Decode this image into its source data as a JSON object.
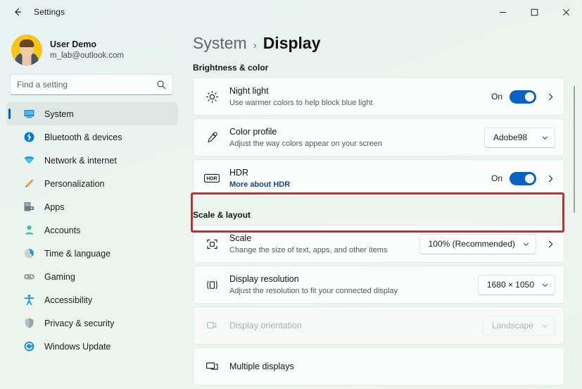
{
  "window": {
    "title": "Settings",
    "back_label": "back-arrow",
    "minimize_label": "Minimize",
    "maximize_label": "Maximize",
    "close_label": "Close"
  },
  "profile": {
    "name": "User Demo",
    "email": "m_lab@outlook.com"
  },
  "search": {
    "placeholder": "Find a setting",
    "value": ""
  },
  "sidebar": {
    "items": [
      {
        "label": "System",
        "icon": "monitor-icon",
        "active": true
      },
      {
        "label": "Bluetooth & devices",
        "icon": "bluetooth-icon",
        "active": false
      },
      {
        "label": "Network & internet",
        "icon": "wifi-icon",
        "active": false
      },
      {
        "label": "Personalization",
        "icon": "brush-icon",
        "active": false
      },
      {
        "label": "Apps",
        "icon": "apps-icon",
        "active": false
      },
      {
        "label": "Accounts",
        "icon": "account-icon",
        "active": false
      },
      {
        "label": "Time & language",
        "icon": "clock-icon",
        "active": false
      },
      {
        "label": "Gaming",
        "icon": "gamepad-icon",
        "active": false
      },
      {
        "label": "Accessibility",
        "icon": "accessibility-icon",
        "active": false
      },
      {
        "label": "Privacy & security",
        "icon": "shield-icon",
        "active": false
      },
      {
        "label": "Windows Update",
        "icon": "update-icon",
        "active": false
      }
    ]
  },
  "breadcrumb": {
    "parent": "System",
    "separator": "›",
    "current": "Display"
  },
  "sections": [
    {
      "heading": "Brightness & color",
      "rows": [
        {
          "icon": "brightness-icon",
          "title": "Night light",
          "subtitle": "Use warmer colors to help block blue light",
          "control": "toggle",
          "toggle_state": "On",
          "has_chevron": true,
          "disabled": false
        },
        {
          "icon": "eyedropper-icon",
          "title": "Color profile",
          "subtitle": "Adjust the way colors appear on your screen",
          "control": "dropdown",
          "dropdown_value": "Adobe98",
          "has_chevron": false,
          "disabled": false
        },
        {
          "icon": "hdr-icon",
          "title": "HDR",
          "subtitle": "More about HDR",
          "subtitle_is_link": true,
          "control": "toggle",
          "toggle_state": "On",
          "has_chevron": true,
          "disabled": false,
          "highlighted": true
        }
      ]
    },
    {
      "heading": "Scale & layout",
      "rows": [
        {
          "icon": "scale-icon",
          "title": "Scale",
          "subtitle": "Change the size of text, apps, and other items",
          "control": "dropdown",
          "dropdown_value": "100% (Recommended)",
          "has_chevron": true,
          "disabled": false
        },
        {
          "icon": "resolution-icon",
          "title": "Display resolution",
          "subtitle": "Adjust the resolution to fit your connected display",
          "control": "dropdown",
          "dropdown_value": "1680 × 1050",
          "has_chevron": false,
          "disabled": false
        },
        {
          "icon": "orientation-icon",
          "title": "Display orientation",
          "subtitle": "",
          "control": "dropdown",
          "dropdown_value": "Landscape",
          "has_chevron": false,
          "disabled": true
        },
        {
          "icon": "multiple-displays-icon",
          "title": "Multiple displays",
          "subtitle": "",
          "control": "none",
          "has_chevron": false,
          "disabled": false
        }
      ]
    }
  ],
  "colors": {
    "accent": "#0a62c3",
    "highlight": "#e0232b",
    "link": "#12478f"
  }
}
